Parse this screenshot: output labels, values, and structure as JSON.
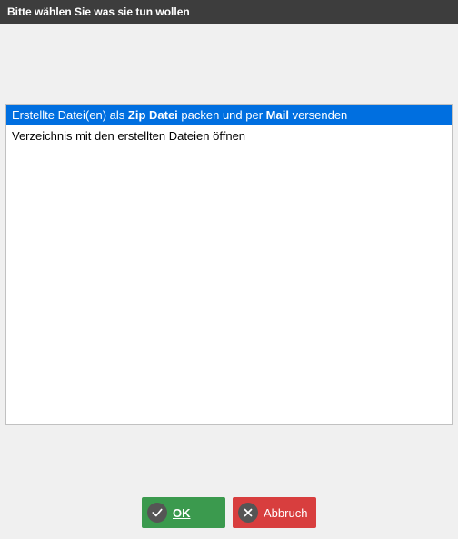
{
  "window": {
    "title": "Bitte wählen Sie was sie tun wollen"
  },
  "options": [
    {
      "segments": [
        {
          "text": "Erstellte Datei(en) als ",
          "bold": false
        },
        {
          "text": "Zip Datei",
          "bold": true
        },
        {
          "text": " packen und per ",
          "bold": false
        },
        {
          "text": "Mail",
          "bold": true
        },
        {
          "text": " versenden",
          "bold": false
        }
      ],
      "selected": true
    },
    {
      "segments": [
        {
          "text": "Verzeichnis mit den erstellten Dateien öffnen",
          "bold": false
        }
      ],
      "selected": false
    }
  ],
  "buttons": {
    "ok_label": "OK",
    "cancel_label": "Abbruch"
  }
}
